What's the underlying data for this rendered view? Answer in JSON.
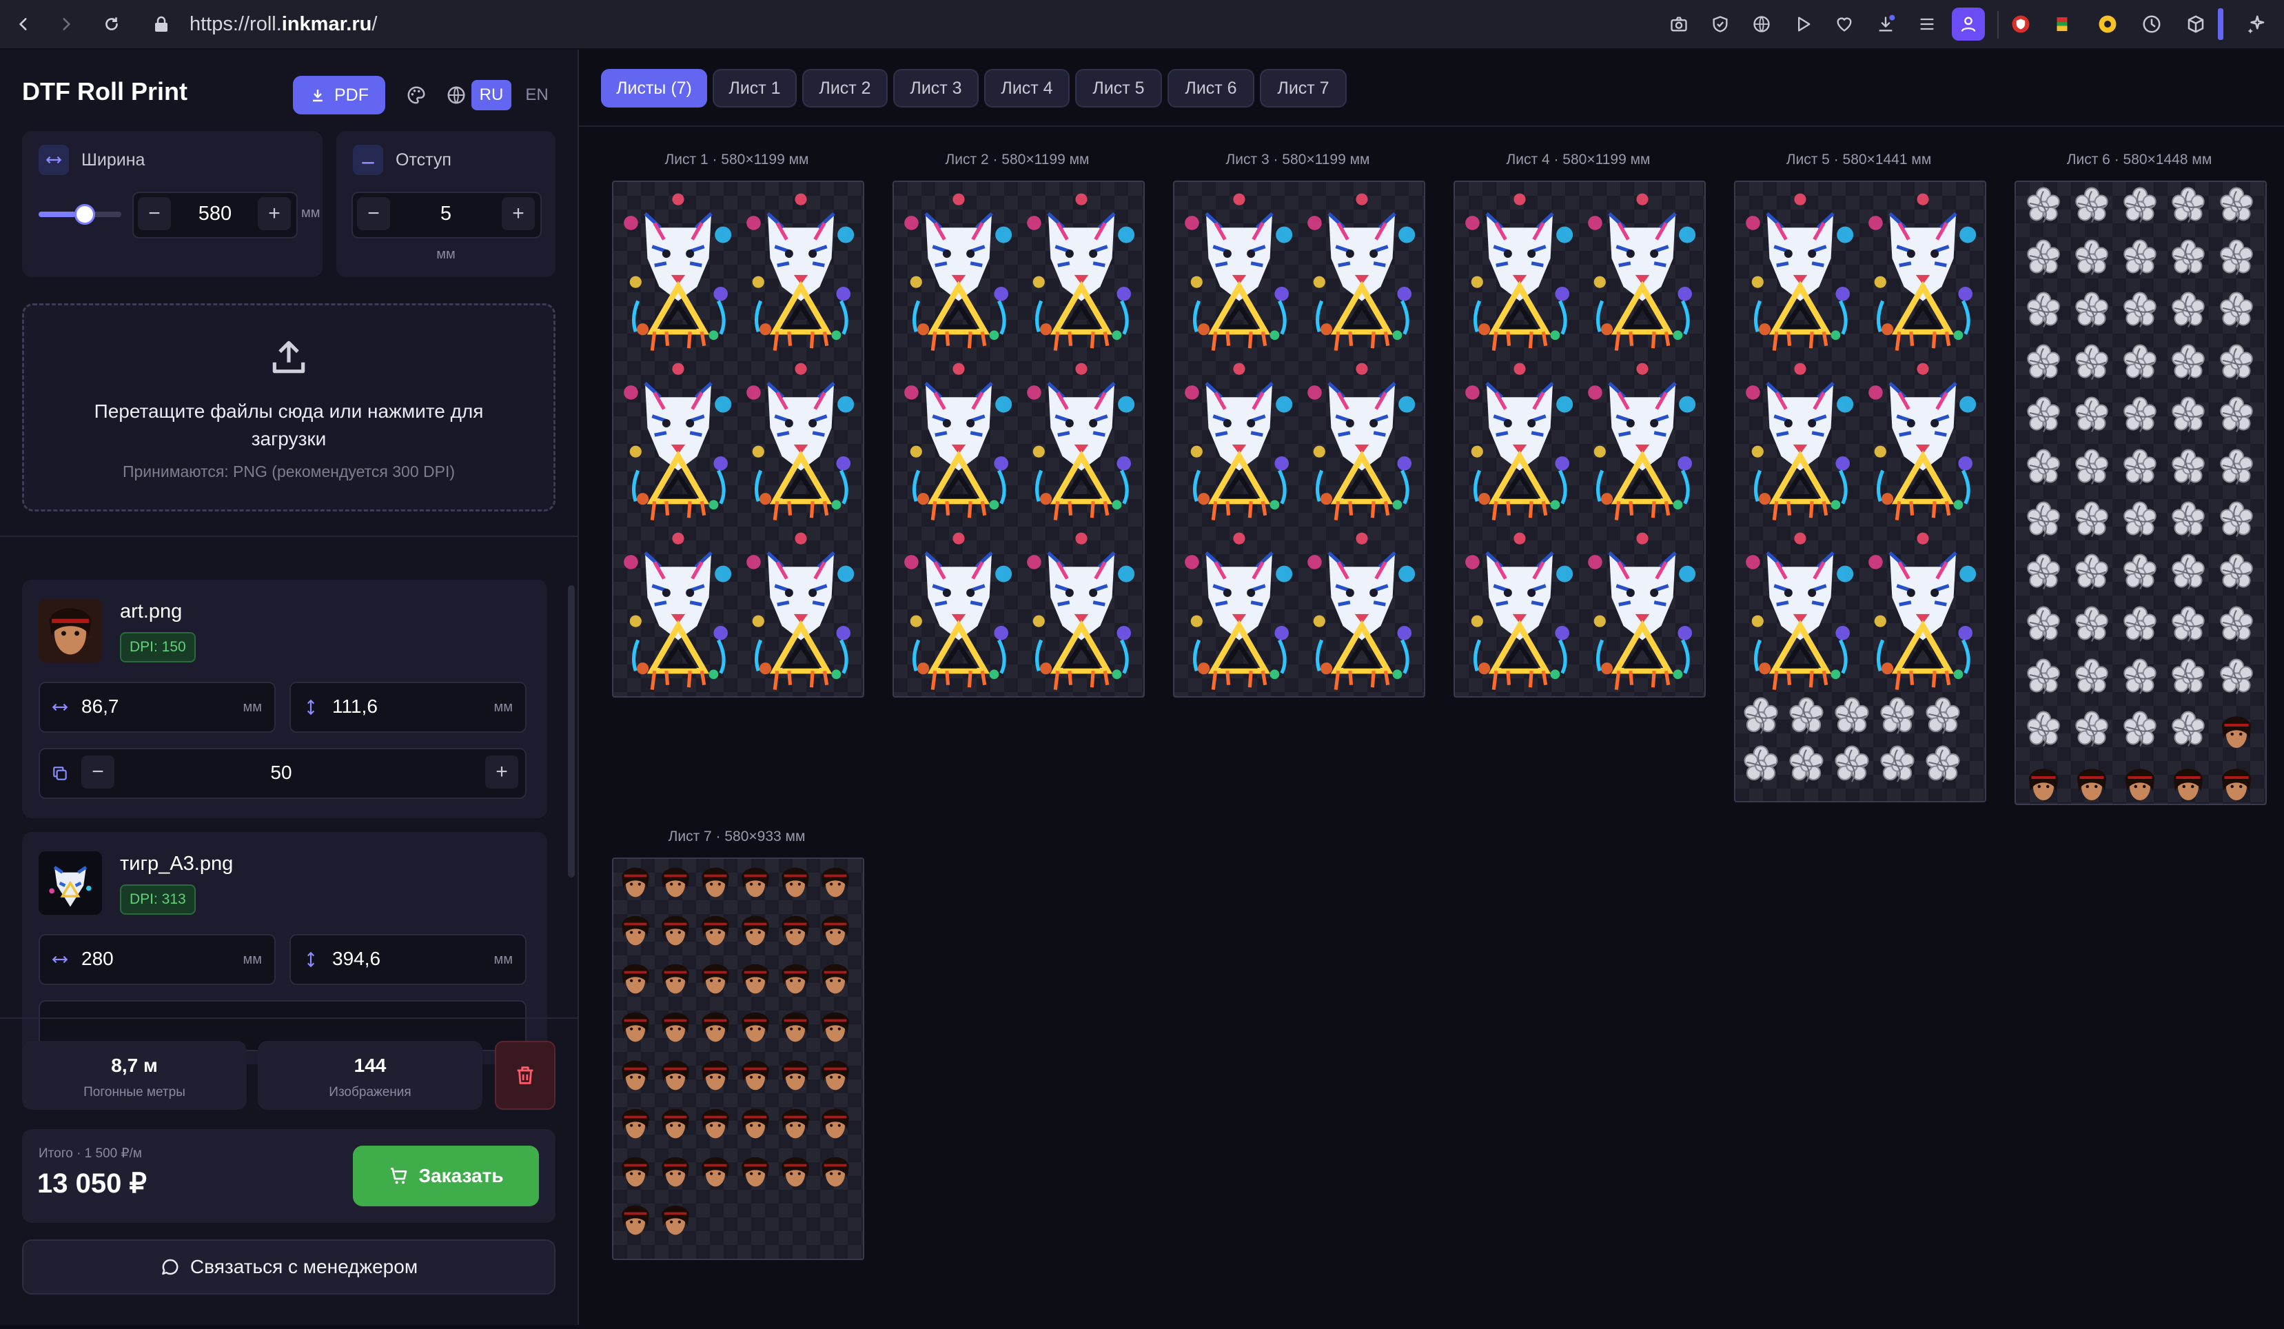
{
  "browser": {
    "url_prefix": "https://roll.",
    "url_host": "inkmar.ru",
    "url_suffix": "/"
  },
  "app": {
    "title": "DTF Roll Print",
    "pdf_label": "PDF",
    "lang_ru": "RU",
    "lang_en": "EN",
    "accent": "#6366f1",
    "success": "#3fae4a",
    "danger": "#e05260"
  },
  "width_panel": {
    "label": "Ширина",
    "value": "580",
    "unit": "мм",
    "slider_fraction": 0.45
  },
  "gap_panel": {
    "label": "Отступ",
    "value": "5",
    "unit": "мм"
  },
  "upload": {
    "line1": "Перетащите файлы сюда или нажмите для",
    "line2": "загрузки",
    "hint": "Принимаются: PNG (рекомендуется 300 DPI)"
  },
  "files": [
    {
      "name": "art.png",
      "dpi": "DPI: 150",
      "width": "86,7",
      "height": "111,6",
      "unit": "мм",
      "count": "50"
    },
    {
      "name": "тигр_А3.png",
      "dpi": "DPI: 313",
      "width": "280",
      "height": "394,6",
      "unit": "мм"
    }
  ],
  "stats": {
    "meters_value": "8,7 м",
    "meters_label": "Погонные метры",
    "images_value": "144",
    "images_label": "Изображения"
  },
  "total": {
    "label": "Итого · 1 500 ₽/м",
    "value": "13 050 ₽",
    "order_label": "Заказать"
  },
  "contact_label": "Связаться с менеджером",
  "tabs": [
    "Листы (7)",
    "Лист 1",
    "Лист 2",
    "Лист 3",
    "Лист 4",
    "Лист 5",
    "Лист 6",
    "Лист 7"
  ],
  "sheets": [
    {
      "label": "Лист 1 · 580×1199 мм"
    },
    {
      "label": "Лист 2 · 580×1199 мм"
    },
    {
      "label": "Лист 3 · 580×1199 мм"
    },
    {
      "label": "Лист 4 · 580×1199 мм"
    },
    {
      "label": "Лист 5 · 580×1441 мм"
    },
    {
      "label": "Лист 6 · 580×1448 мм"
    },
    {
      "label": "Лист 7 · 580×933 мм"
    }
  ]
}
